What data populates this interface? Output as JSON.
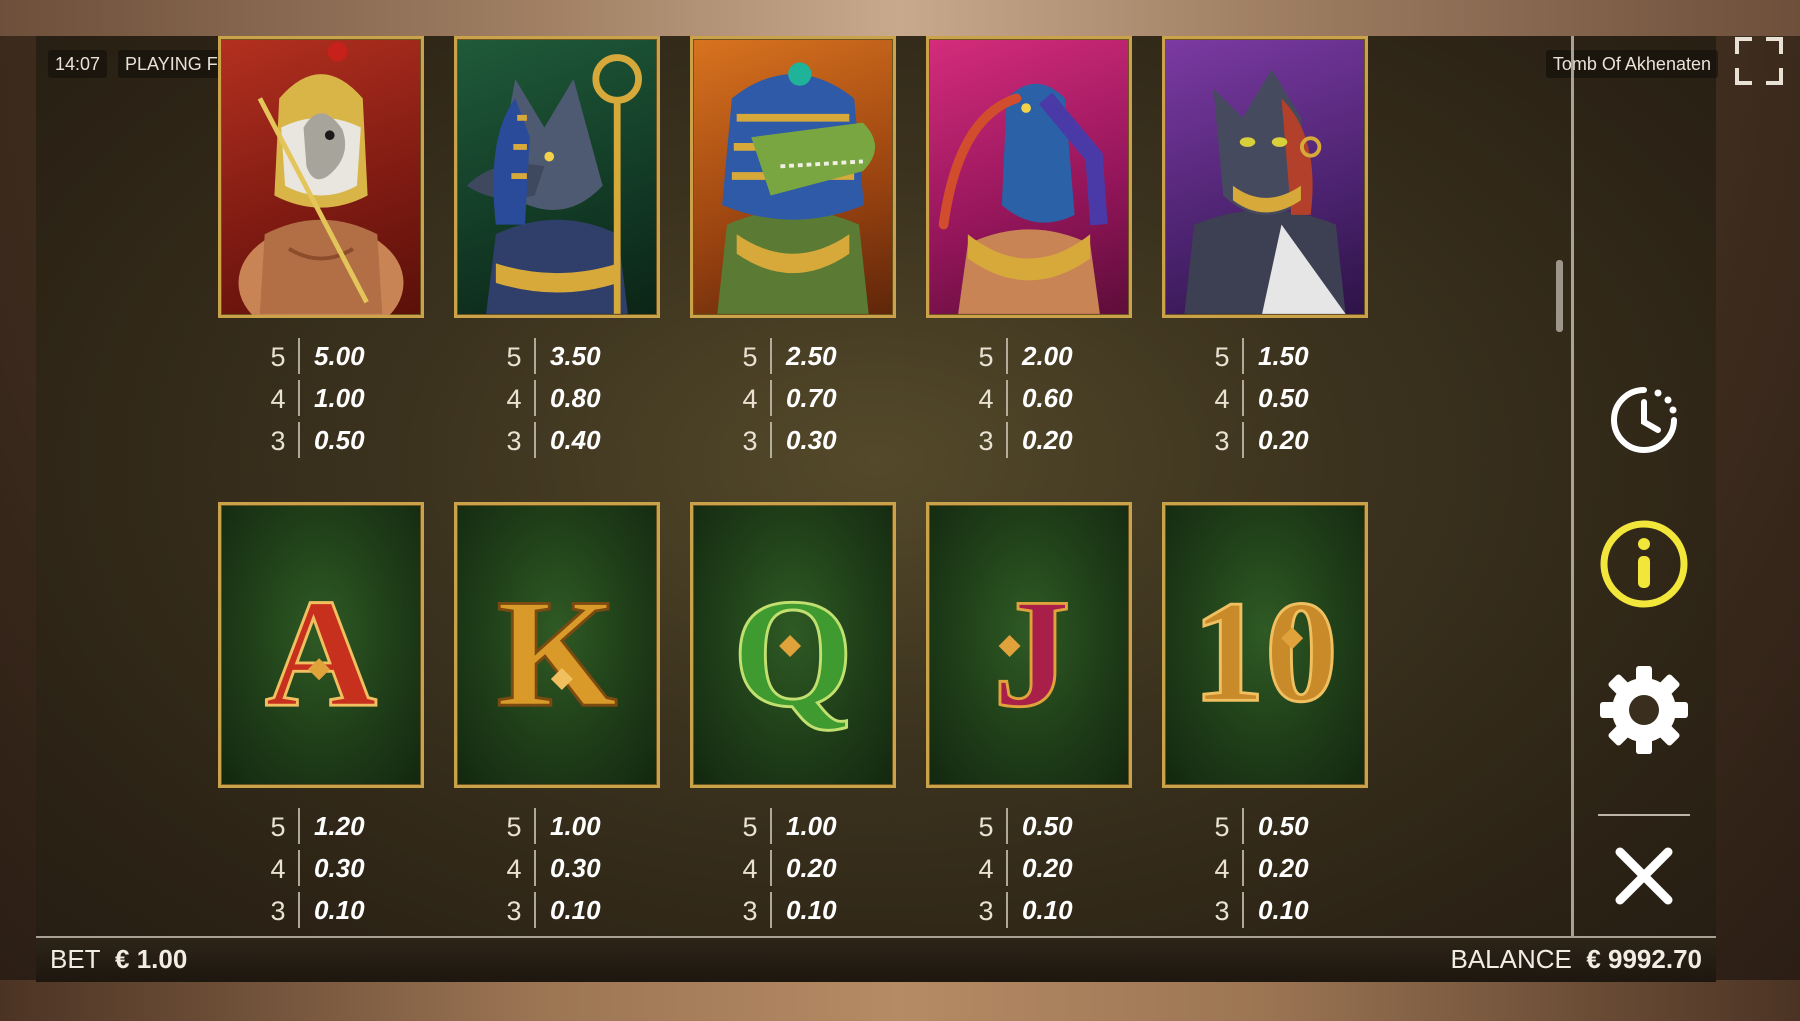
{
  "header": {
    "time": "14:07",
    "mode": "PLAYING FOR FUN",
    "game_title": "Tomb Of Akhenaten"
  },
  "icons": {
    "fullscreen": "fullscreen-icon",
    "history": "clock-history-icon",
    "info": "info-icon",
    "settings": "gear-icon",
    "close": "close-icon"
  },
  "colors": {
    "card_border": "#c9a24a",
    "info_accent": "#f3e63a",
    "text": "#ffffff"
  },
  "paytable": {
    "high_symbols": [
      {
        "name": "Horus",
        "counts": [
          "5",
          "4",
          "3"
        ],
        "values": [
          "5.00",
          "1.00",
          "0.50"
        ]
      },
      {
        "name": "Anubis",
        "counts": [
          "5",
          "4",
          "3"
        ],
        "values": [
          "3.50",
          "0.80",
          "0.40"
        ]
      },
      {
        "name": "Sobek",
        "counts": [
          "5",
          "4",
          "3"
        ],
        "values": [
          "2.50",
          "0.70",
          "0.30"
        ]
      },
      {
        "name": "Thoth",
        "counts": [
          "5",
          "4",
          "3"
        ],
        "values": [
          "2.00",
          "0.60",
          "0.20"
        ]
      },
      {
        "name": "Bastet",
        "counts": [
          "5",
          "4",
          "3"
        ],
        "values": [
          "1.50",
          "0.50",
          "0.20"
        ]
      }
    ],
    "low_symbols": [
      {
        "name": "A",
        "counts": [
          "5",
          "4",
          "3"
        ],
        "values": [
          "1.20",
          "0.30",
          "0.10"
        ]
      },
      {
        "name": "K",
        "counts": [
          "5",
          "4",
          "3"
        ],
        "values": [
          "1.00",
          "0.30",
          "0.10"
        ]
      },
      {
        "name": "Q",
        "counts": [
          "5",
          "4",
          "3"
        ],
        "values": [
          "1.00",
          "0.20",
          "0.10"
        ]
      },
      {
        "name": "J",
        "counts": [
          "5",
          "4",
          "3"
        ],
        "values": [
          "0.50",
          "0.20",
          "0.10"
        ]
      },
      {
        "name": "10",
        "counts": [
          "5",
          "4",
          "3"
        ],
        "values": [
          "0.50",
          "0.20",
          "0.10"
        ]
      }
    ]
  },
  "footer": {
    "bet_label": "BET",
    "bet_value": "€ 1.00",
    "balance_label": "BALANCE",
    "balance_value": "€ 9992.70"
  }
}
